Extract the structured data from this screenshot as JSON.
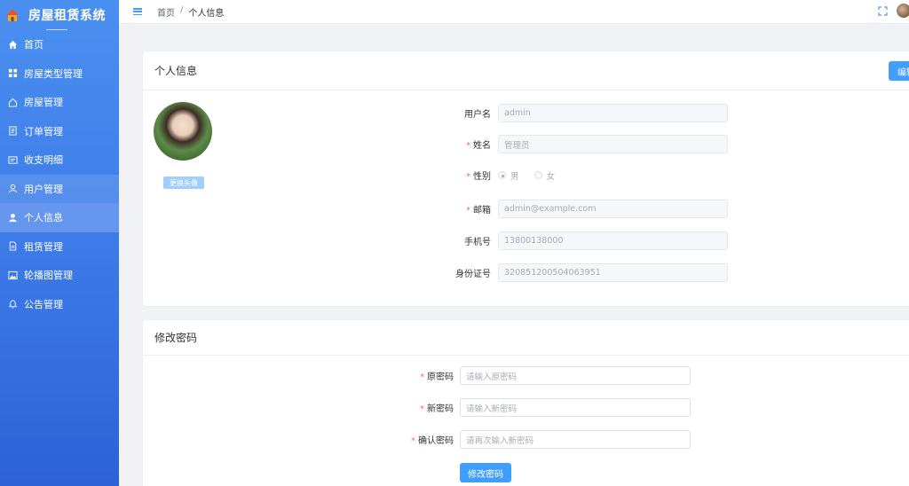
{
  "app": {
    "title": "房屋租赁系统"
  },
  "sidebar": {
    "items": [
      {
        "label": "首页",
        "icon": "home-icon"
      },
      {
        "label": "房屋类型管理",
        "icon": "grid-icon"
      },
      {
        "label": "房屋管理",
        "icon": "house-icon"
      },
      {
        "label": "订单管理",
        "icon": "order-icon"
      },
      {
        "label": "收支明细",
        "icon": "finance-icon"
      },
      {
        "label": "用户管理",
        "icon": "user-outline-icon"
      },
      {
        "label": "个人信息",
        "icon": "user-filled-icon"
      },
      {
        "label": "租赁管理",
        "icon": "document-icon"
      },
      {
        "label": "轮播图管理",
        "icon": "image-icon"
      },
      {
        "label": "公告管理",
        "icon": "bell-icon"
      }
    ],
    "active_index": 6
  },
  "header": {
    "breadcrumb": [
      "首页",
      "个人信息"
    ],
    "separator": "/"
  },
  "profile": {
    "title": "个人信息",
    "edit_label": "编辑",
    "change_avatar_label": "更换头像",
    "fields": {
      "username": {
        "label": "用户名",
        "value": "admin"
      },
      "name": {
        "label": "姓名",
        "value": "管理员"
      },
      "gender": {
        "label": "性别",
        "options": [
          "男",
          "女"
        ],
        "selected": "男"
      },
      "email": {
        "label": "邮箱",
        "value": "admin@example.com"
      },
      "phone": {
        "label": "手机号",
        "value": "13800138000"
      },
      "idcard": {
        "label": "身份证号",
        "value": "320851200504063951"
      }
    }
  },
  "password": {
    "title": "修改密码",
    "old": {
      "label": "原密码",
      "placeholder": "请输入原密码"
    },
    "new": {
      "label": "新密码",
      "placeholder": "请输入新密码"
    },
    "confirm": {
      "label": "确认密码",
      "placeholder": "请再次输入新密码"
    },
    "submit_label": "修改密码"
  },
  "colors": {
    "primary": "#409eff",
    "sidebar_top": "#4a90f0",
    "sidebar_bottom": "#2c62d6",
    "required": "#f56c6c"
  }
}
